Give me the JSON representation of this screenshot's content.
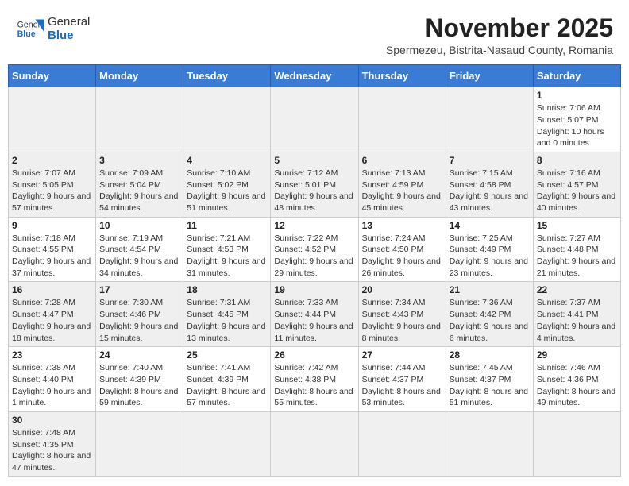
{
  "logo": {
    "general": "General",
    "blue": "Blue"
  },
  "header": {
    "month_year": "November 2025",
    "subtitle": "Spermezeu, Bistrita-Nasaud County, Romania"
  },
  "days_of_week": [
    "Sunday",
    "Monday",
    "Tuesday",
    "Wednesday",
    "Thursday",
    "Friday",
    "Saturday"
  ],
  "weeks": [
    [
      {
        "day": "",
        "info": ""
      },
      {
        "day": "",
        "info": ""
      },
      {
        "day": "",
        "info": ""
      },
      {
        "day": "",
        "info": ""
      },
      {
        "day": "",
        "info": ""
      },
      {
        "day": "",
        "info": ""
      },
      {
        "day": "1",
        "info": "Sunrise: 7:06 AM\nSunset: 5:07 PM\nDaylight: 10 hours and 0 minutes."
      }
    ],
    [
      {
        "day": "2",
        "info": "Sunrise: 7:07 AM\nSunset: 5:05 PM\nDaylight: 9 hours and 57 minutes."
      },
      {
        "day": "3",
        "info": "Sunrise: 7:09 AM\nSunset: 5:04 PM\nDaylight: 9 hours and 54 minutes."
      },
      {
        "day": "4",
        "info": "Sunrise: 7:10 AM\nSunset: 5:02 PM\nDaylight: 9 hours and 51 minutes."
      },
      {
        "day": "5",
        "info": "Sunrise: 7:12 AM\nSunset: 5:01 PM\nDaylight: 9 hours and 48 minutes."
      },
      {
        "day": "6",
        "info": "Sunrise: 7:13 AM\nSunset: 4:59 PM\nDaylight: 9 hours and 45 minutes."
      },
      {
        "day": "7",
        "info": "Sunrise: 7:15 AM\nSunset: 4:58 PM\nDaylight: 9 hours and 43 minutes."
      },
      {
        "day": "8",
        "info": "Sunrise: 7:16 AM\nSunset: 4:57 PM\nDaylight: 9 hours and 40 minutes."
      }
    ],
    [
      {
        "day": "9",
        "info": "Sunrise: 7:18 AM\nSunset: 4:55 PM\nDaylight: 9 hours and 37 minutes."
      },
      {
        "day": "10",
        "info": "Sunrise: 7:19 AM\nSunset: 4:54 PM\nDaylight: 9 hours and 34 minutes."
      },
      {
        "day": "11",
        "info": "Sunrise: 7:21 AM\nSunset: 4:53 PM\nDaylight: 9 hours and 31 minutes."
      },
      {
        "day": "12",
        "info": "Sunrise: 7:22 AM\nSunset: 4:52 PM\nDaylight: 9 hours and 29 minutes."
      },
      {
        "day": "13",
        "info": "Sunrise: 7:24 AM\nSunset: 4:50 PM\nDaylight: 9 hours and 26 minutes."
      },
      {
        "day": "14",
        "info": "Sunrise: 7:25 AM\nSunset: 4:49 PM\nDaylight: 9 hours and 23 minutes."
      },
      {
        "day": "15",
        "info": "Sunrise: 7:27 AM\nSunset: 4:48 PM\nDaylight: 9 hours and 21 minutes."
      }
    ],
    [
      {
        "day": "16",
        "info": "Sunrise: 7:28 AM\nSunset: 4:47 PM\nDaylight: 9 hours and 18 minutes."
      },
      {
        "day": "17",
        "info": "Sunrise: 7:30 AM\nSunset: 4:46 PM\nDaylight: 9 hours and 15 minutes."
      },
      {
        "day": "18",
        "info": "Sunrise: 7:31 AM\nSunset: 4:45 PM\nDaylight: 9 hours and 13 minutes."
      },
      {
        "day": "19",
        "info": "Sunrise: 7:33 AM\nSunset: 4:44 PM\nDaylight: 9 hours and 11 minutes."
      },
      {
        "day": "20",
        "info": "Sunrise: 7:34 AM\nSunset: 4:43 PM\nDaylight: 9 hours and 8 minutes."
      },
      {
        "day": "21",
        "info": "Sunrise: 7:36 AM\nSunset: 4:42 PM\nDaylight: 9 hours and 6 minutes."
      },
      {
        "day": "22",
        "info": "Sunrise: 7:37 AM\nSunset: 4:41 PM\nDaylight: 9 hours and 4 minutes."
      }
    ],
    [
      {
        "day": "23",
        "info": "Sunrise: 7:38 AM\nSunset: 4:40 PM\nDaylight: 9 hours and 1 minute."
      },
      {
        "day": "24",
        "info": "Sunrise: 7:40 AM\nSunset: 4:39 PM\nDaylight: 8 hours and 59 minutes."
      },
      {
        "day": "25",
        "info": "Sunrise: 7:41 AM\nSunset: 4:39 PM\nDaylight: 8 hours and 57 minutes."
      },
      {
        "day": "26",
        "info": "Sunrise: 7:42 AM\nSunset: 4:38 PM\nDaylight: 8 hours and 55 minutes."
      },
      {
        "day": "27",
        "info": "Sunrise: 7:44 AM\nSunset: 4:37 PM\nDaylight: 8 hours and 53 minutes."
      },
      {
        "day": "28",
        "info": "Sunrise: 7:45 AM\nSunset: 4:37 PM\nDaylight: 8 hours and 51 minutes."
      },
      {
        "day": "29",
        "info": "Sunrise: 7:46 AM\nSunset: 4:36 PM\nDaylight: 8 hours and 49 minutes."
      }
    ],
    [
      {
        "day": "30",
        "info": "Sunrise: 7:48 AM\nSunset: 4:35 PM\nDaylight: 8 hours and 47 minutes."
      },
      {
        "day": "",
        "info": ""
      },
      {
        "day": "",
        "info": ""
      },
      {
        "day": "",
        "info": ""
      },
      {
        "day": "",
        "info": ""
      },
      {
        "day": "",
        "info": ""
      },
      {
        "day": "",
        "info": ""
      }
    ]
  ]
}
